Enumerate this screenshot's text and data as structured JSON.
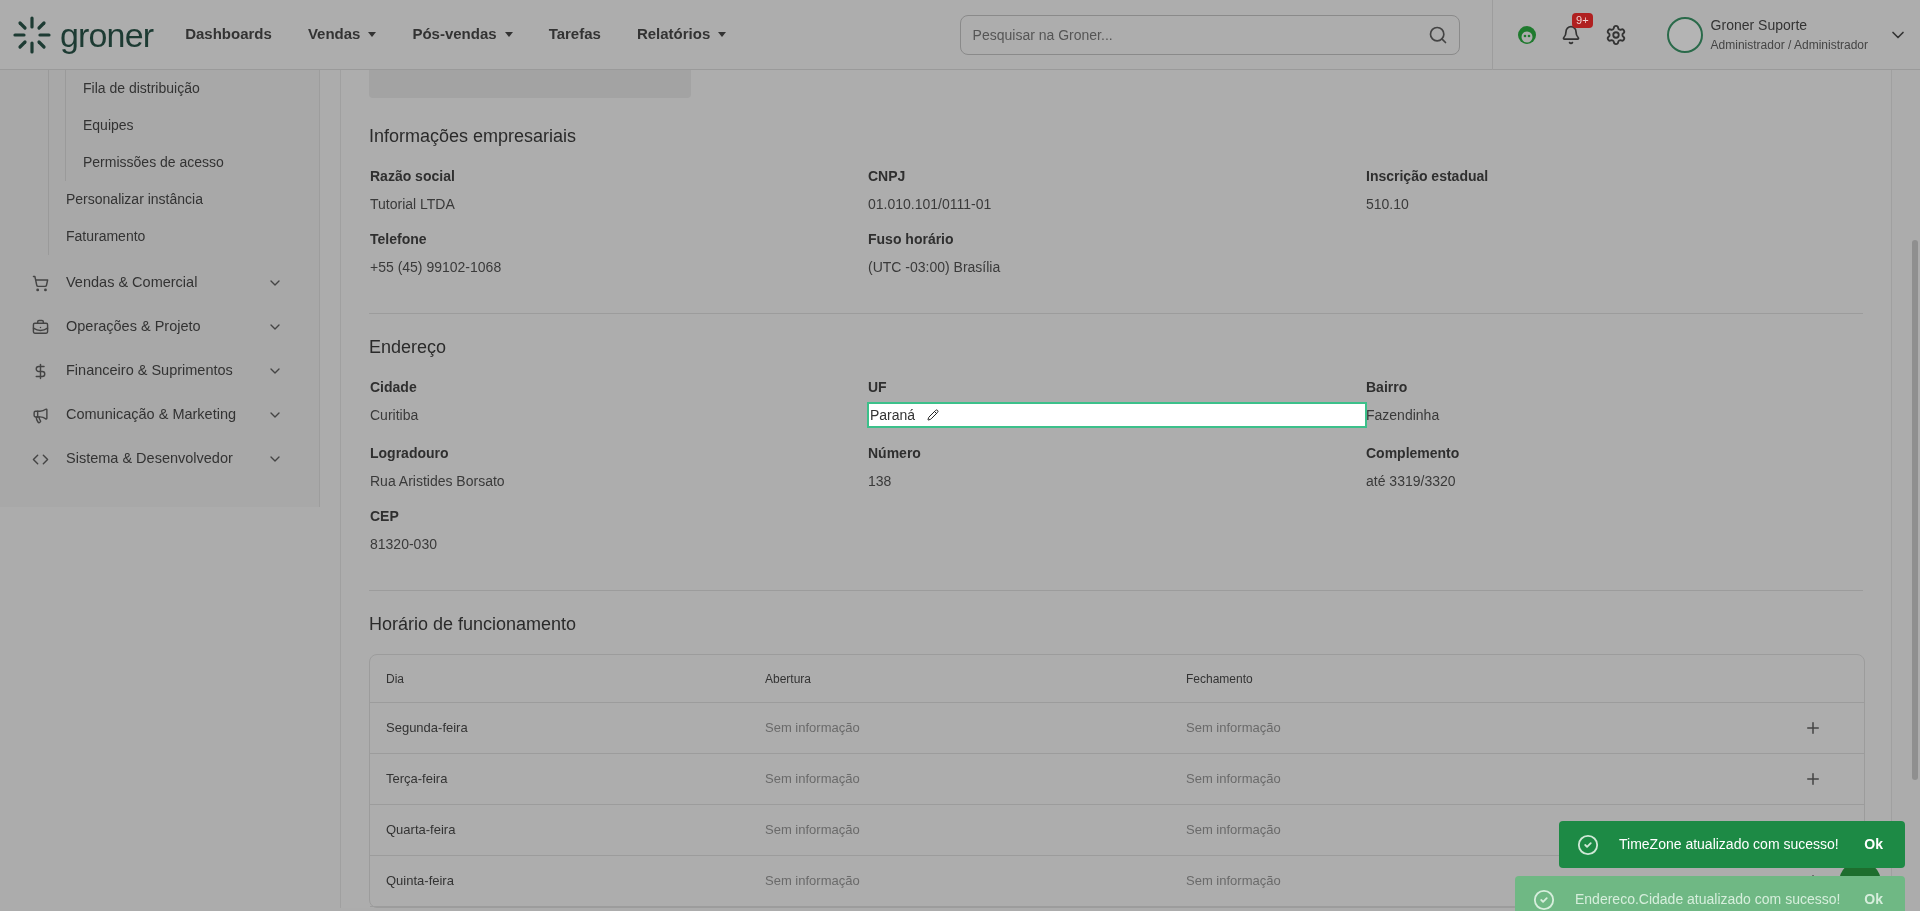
{
  "header": {
    "logo_text": "groner",
    "nav": [
      {
        "label": "Dashboards",
        "dropdown": false
      },
      {
        "label": "Vendas",
        "dropdown": true
      },
      {
        "label": "Pós-vendas",
        "dropdown": true
      },
      {
        "label": "Tarefas",
        "dropdown": false
      },
      {
        "label": "Relatórios",
        "dropdown": true
      }
    ],
    "search": {
      "placeholder": "Pesquisar na Groner..."
    },
    "notifications_badge": "9+",
    "user": {
      "name": "Groner Suporte",
      "role": "Administrador / Administrador"
    }
  },
  "sidebar": {
    "items": [
      {
        "children": [
          {
            "label": "Fila de distribuição"
          },
          {
            "label": "Equipes"
          },
          {
            "label": "Permissões de acesso"
          }
        ]
      },
      {
        "label": "Personalizar instância"
      },
      {
        "label": "Faturamento"
      }
    ],
    "sections": [
      {
        "label": "Vendas & Comercial",
        "expanded": false
      },
      {
        "label": "Operações & Projeto",
        "expanded": false
      },
      {
        "label": "Financeiro & Suprimentos",
        "expanded": false
      },
      {
        "label": "Comunicação & Marketing",
        "expanded": false
      },
      {
        "label": "Sistema & Desenvolvedor",
        "expanded": false
      }
    ]
  },
  "sections": [
    {
      "title": "Informações empresariais",
      "fields": [
        {
          "label": "Razão social",
          "value": "Tutorial LTDA",
          "editing": false
        },
        {
          "label": "CNPJ",
          "value": "01.010.101/0111-01",
          "editing": false
        },
        {
          "label": "Inscrição estadual",
          "value": "510.10",
          "editing": false
        },
        {
          "label": "Telefone",
          "value": "+55 (45) 99102-1068",
          "editing": false
        },
        {
          "label": "Fuso horário",
          "value": "(UTC -03:00) Brasília",
          "editing": false
        }
      ]
    },
    {
      "title": "Endereço",
      "fields": [
        {
          "label": "Cidade",
          "value": "Curitiba",
          "editing": false
        },
        {
          "label": "UF",
          "value": "Paraná",
          "editing": true
        },
        {
          "label": "Bairro",
          "value": "Fazendinha",
          "editing": false
        },
        {
          "label": "Logradouro",
          "value": "Rua Aristides Borsato",
          "editing": false
        },
        {
          "label": "Número",
          "value": "138",
          "editing": false
        },
        {
          "label": "Complemento",
          "value": "até 3319/3320",
          "editing": false
        },
        {
          "label": "CEP",
          "value": "81320-030",
          "editing": false
        }
      ]
    }
  ],
  "hours": {
    "title": "Horário de funcionamento",
    "columns": [
      "Dia",
      "Abertura",
      "Fechamento"
    ],
    "rows": [
      {
        "day": "Segunda-feira",
        "opening": "Sem informação",
        "closing": "Sem informação",
        "add_button": true
      },
      {
        "day": "Terça-feira",
        "opening": "Sem informação",
        "closing": "Sem informação",
        "add_button": true
      },
      {
        "day": "Quarta-feira",
        "opening": "Sem informação",
        "closing": "Sem informação",
        "add_button": false
      },
      {
        "day": "Quinta-feira",
        "opening": "Sem informação",
        "closing": "Sem informação",
        "add_button": true
      }
    ]
  },
  "toasts": [
    {
      "message": "TimeZone atualizado com sucesso!",
      "action": "Ok",
      "faded": false
    },
    {
      "message": "Endereco.Cidade atualizado com sucesso!",
      "action": "Ok",
      "faded": true
    }
  ]
}
